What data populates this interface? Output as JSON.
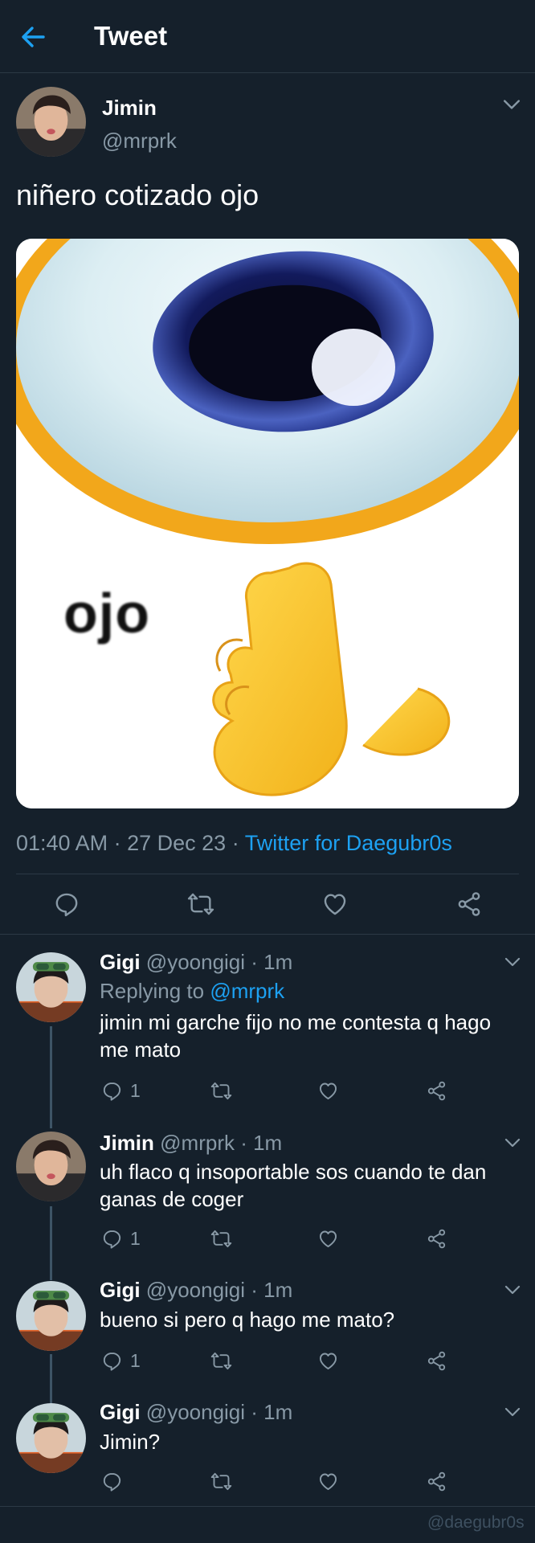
{
  "header": {
    "title": "Tweet",
    "back_icon": "arrow-left-icon"
  },
  "tweet": {
    "name": "Jimin",
    "handle": "@mrprk",
    "text": "niñero cotizado ojo",
    "media_text": "ojo",
    "time": "01:40 AM",
    "date": "27 Dec 23",
    "source": "Twitter for Daegubr0s",
    "sep1": "·",
    "sep2": "·"
  },
  "replies": [
    {
      "name": "Gigi",
      "handle": "@yoongigi · 1m",
      "replying_prefix": "Replying to ",
      "replying_to": "@mrprk",
      "text": "jimin mi garche fijo no me contesta q hago me mato",
      "reply_count": "1"
    },
    {
      "name": "Jimin",
      "handle": "@mrprk · 1m",
      "text": "uh flaco q insoportable sos cuando te dan ganas de coger",
      "reply_count": "1"
    },
    {
      "name": "Gigi",
      "handle": "@yoongigi · 1m",
      "text": "bueno si pero q hago me mato?",
      "reply_count": "1"
    },
    {
      "name": "Gigi",
      "handle": "@yoongigi · 1m",
      "text": "Jimin?",
      "reply_count": ""
    }
  ],
  "watermark": "@daegubr0s",
  "colors": {
    "background": "#15202b",
    "accent": "#1da1f2",
    "muted": "#8899a6",
    "divider": "#2c3945"
  }
}
